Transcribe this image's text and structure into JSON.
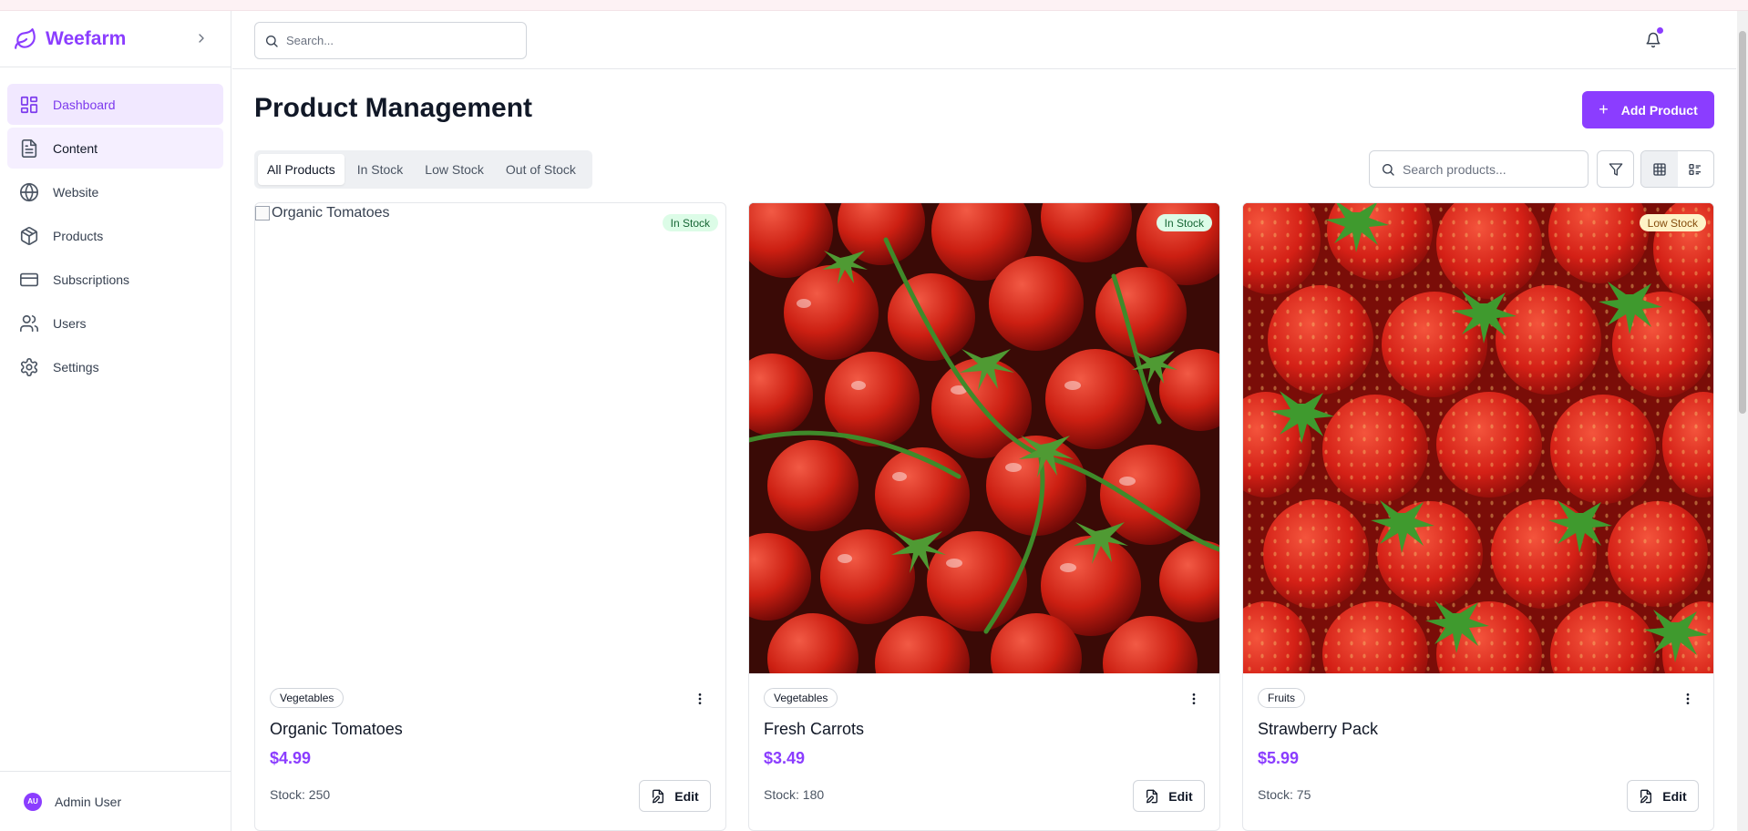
{
  "colors": {
    "accent": "#8b3dff",
    "in_stock_bg": "#dcfce7",
    "low_stock_bg": "#fef3c7"
  },
  "brand": {
    "name": "Weefarm",
    "logo_icon": "leaf-icon"
  },
  "sidebar": {
    "items": [
      {
        "label": "Dashboard",
        "icon": "dashboard-icon"
      },
      {
        "label": "Content",
        "icon": "document-icon"
      },
      {
        "label": "Website",
        "icon": "globe-icon"
      },
      {
        "label": "Products",
        "icon": "box-icon"
      },
      {
        "label": "Subscriptions",
        "icon": "credit-card-icon"
      },
      {
        "label": "Users",
        "icon": "users-icon"
      },
      {
        "label": "Settings",
        "icon": "gear-icon"
      }
    ],
    "user": {
      "initials": "AU",
      "name": "Admin User"
    }
  },
  "header": {
    "search_placeholder": "Search..."
  },
  "main": {
    "title": "Product Management",
    "add_label": "Add Product",
    "tabs": [
      "All Products",
      "In Stock",
      "Low Stock",
      "Out of Stock"
    ],
    "search_placeholder": "Search products..."
  },
  "products": [
    {
      "name": "Organic Tomatoes",
      "alt": "Organic Tomatoes",
      "category": "Vegetables",
      "price": "$4.99",
      "stock": "Stock: 250",
      "status": "In Stock",
      "edit_label": "Edit"
    },
    {
      "name": "Fresh Carrots",
      "alt": "Fresh Carrots",
      "category": "Vegetables",
      "price": "$3.49",
      "stock": "Stock: 180",
      "status": "In Stock",
      "edit_label": "Edit"
    },
    {
      "name": "Strawberry Pack",
      "alt": "Strawberry Pack",
      "category": "Fruits",
      "price": "$5.99",
      "stock": "Stock: 75",
      "status": "Low Stock",
      "edit_label": "Edit"
    }
  ]
}
